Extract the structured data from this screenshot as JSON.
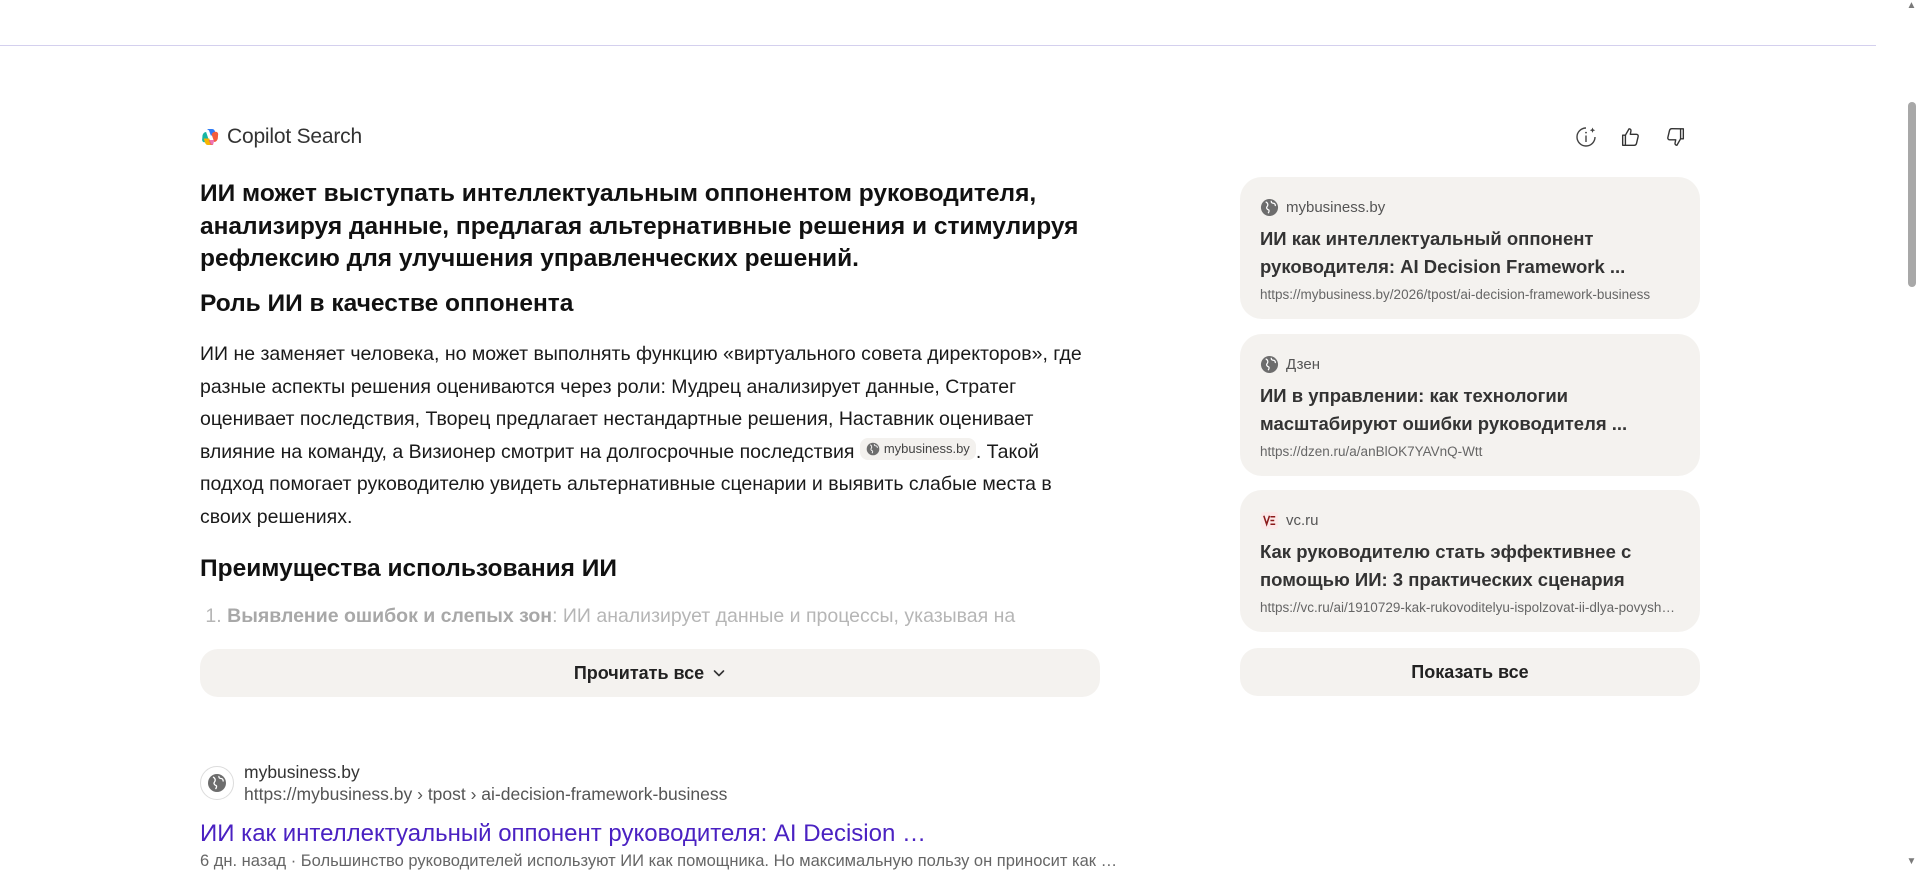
{
  "header": {
    "brand_name": "Copilot Search"
  },
  "answer": {
    "summary": "ИИ может выступать интеллектуальным оппонентом руководителя, анализируя данные, предлагая альтернативные решения и стимулируя рефлексию для улучшения управленческих решений.",
    "role_heading": "Роль ИИ в качестве оппонента",
    "role_paragraph_before": "ИИ не заменяет человека, но может выполнять функцию «виртуального совета директоров», где разные аспекты решения оцениваются через роли: Мудрец анализирует данные, Стратег оценивает последствия, Творец предлагает нестандартные решения, Наставник оценивает влияние на команду, а Визионер смотрит на долгосрочные последствия",
    "role_citation": "mybusiness.by",
    "role_paragraph_after": ". Такой подход помогает руководителю увидеть альтернативные сценарии и выявить слабые места в своих решениях.",
    "benefits_heading": "Преимущества использования ИИ",
    "benefit_1_number": "1.",
    "benefit_1_title": "Выявление ошибок и слепых зон",
    "benefit_1_text": ": ИИ анализирует данные и процессы, указывая на",
    "read_all_label": "Прочитать все"
  },
  "sources": {
    "cards": [
      {
        "site": "mybusiness.by",
        "icon": "globe-icon",
        "title": "ИИ как интеллектуальный оппонент руководителя: AI Decision Framework ...",
        "url": "https://mybusiness.by/2026/tpost/ai-decision-framework-business"
      },
      {
        "site": "Дзен",
        "icon": "globe-icon",
        "title": "ИИ в управлении: как технологии масштабируют ошибки руководителя ...",
        "url": "https://dzen.ru/a/anBlOK7YAVnQ-Wtt"
      },
      {
        "site": "vc.ru",
        "icon": "vc-logo-icon",
        "title": "Как руководителю стать эффективнее с помощью ИИ: 3 практических сценария",
        "url": "https://vc.ru/ai/1910729-kak-rukovoditelyu-ispolzovat-ii-dlya-povyshe..."
      }
    ],
    "show_all_label": "Показать все"
  },
  "result": {
    "site": "mybusiness.by",
    "url": "https://mybusiness.by › tpost › ai-decision-framework-business",
    "title": "ИИ как интеллектуальный оппонент руководителя: AI Decision …",
    "snippet": "6 дн. назад · Большинство руководителей используют ИИ как помощника. Но максимальную пользу он приносит как …"
  },
  "colors": {
    "accent_link": "#4a21c2",
    "card_bg": "#f4f2ef",
    "divider": "#d4d0ee"
  }
}
